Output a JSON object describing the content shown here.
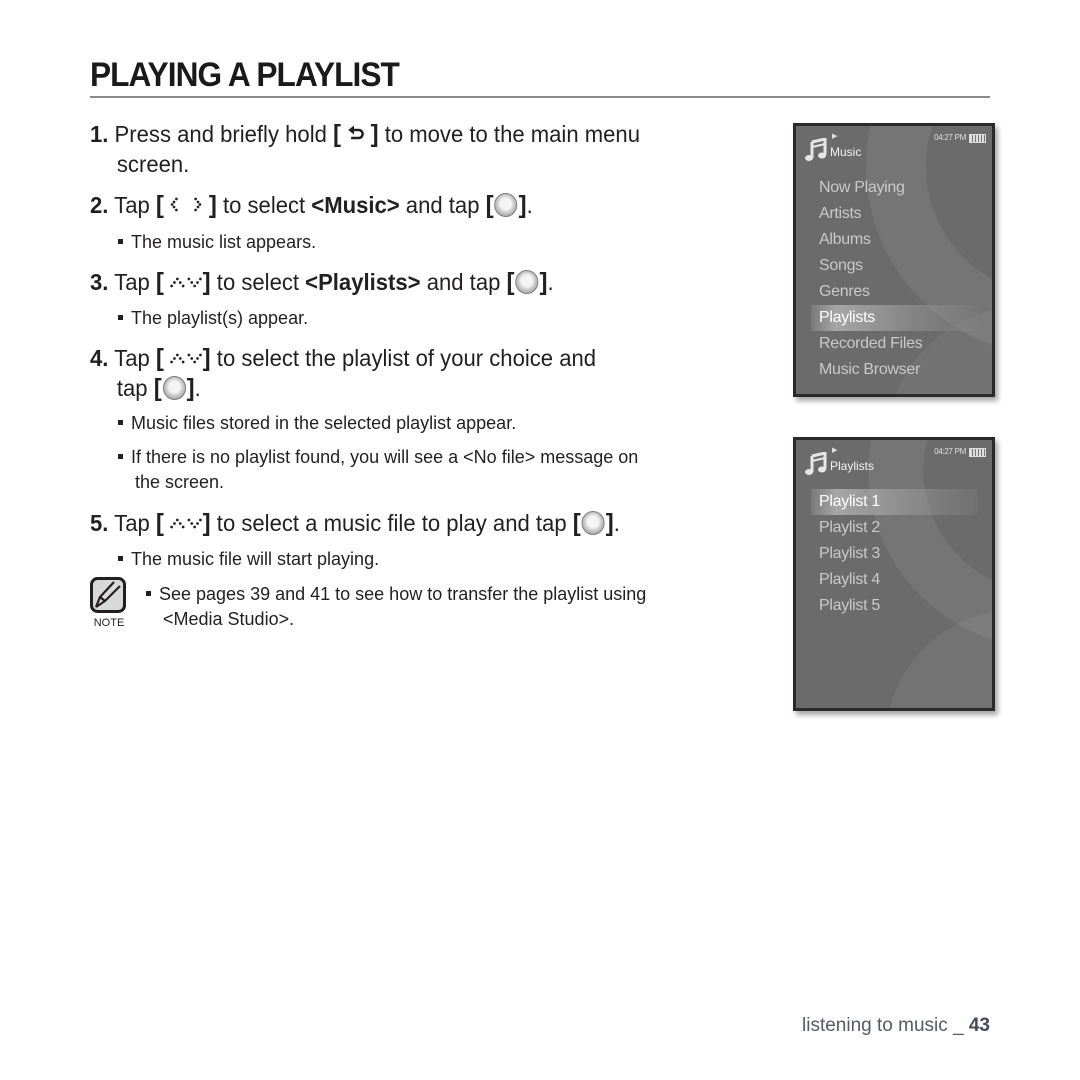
{
  "page": {
    "title": "PLAYING A PLAYLIST",
    "steps": [
      {
        "num": "1.",
        "parts": [
          "Press and briefly hold ",
          " to move to the main menu",
          "screen."
        ],
        "button_icon": "back-icon"
      },
      {
        "num": "2.",
        "parts": [
          "Tap ",
          " to select ",
          "<Music>",
          " and tap ",
          "."
        ],
        "button_icon": "left-right-icon"
      },
      {
        "num": "3.",
        "parts": [
          "Tap ",
          " to select ",
          "<Playlists>",
          " and tap ",
          "."
        ],
        "button_icon": "up-down-icon"
      },
      {
        "num": "4.",
        "parts": [
          "Tap ",
          " to select the playlist of your choice and",
          "tap ",
          "."
        ],
        "button_icon": "up-down-icon"
      },
      {
        "num": "5.",
        "parts": [
          "Tap ",
          " to select a music file to play and tap ",
          "."
        ],
        "button_icon": "up-down-icon"
      }
    ],
    "bullets": {
      "step2": "The music list appears.",
      "step3": "The playlist(s) appear.",
      "step4a": "Music files stored in the selected playlist appear.",
      "step4b_line1": "If there is no playlist found, you will see a <No file> message on",
      "step4b_line2": "the screen.",
      "step5": "The music file will start playing."
    },
    "note": {
      "label": "NOTE",
      "line1": "See pages 39 and 41 to see how to transfer the playlist using",
      "line2": "<Media Studio>."
    },
    "brackets": {
      "open": "[",
      "close": "]"
    },
    "footer": {
      "section": "listening to music _ ",
      "page_number": "43"
    }
  },
  "screens": {
    "music": {
      "title": "Music",
      "time": "04:27 PM",
      "items": [
        "Now Playing",
        "Artists",
        "Albums",
        "Songs",
        "Genres",
        "Playlists",
        "Recorded Files",
        "Music Browser"
      ],
      "selected": "Playlists"
    },
    "playlists": {
      "title": "Playlists",
      "time": "04:27 PM",
      "items": [
        "Playlist 1",
        "Playlist 2",
        "Playlist 3",
        "Playlist 4",
        "Playlist 5"
      ],
      "selected": "Playlist 1"
    }
  }
}
